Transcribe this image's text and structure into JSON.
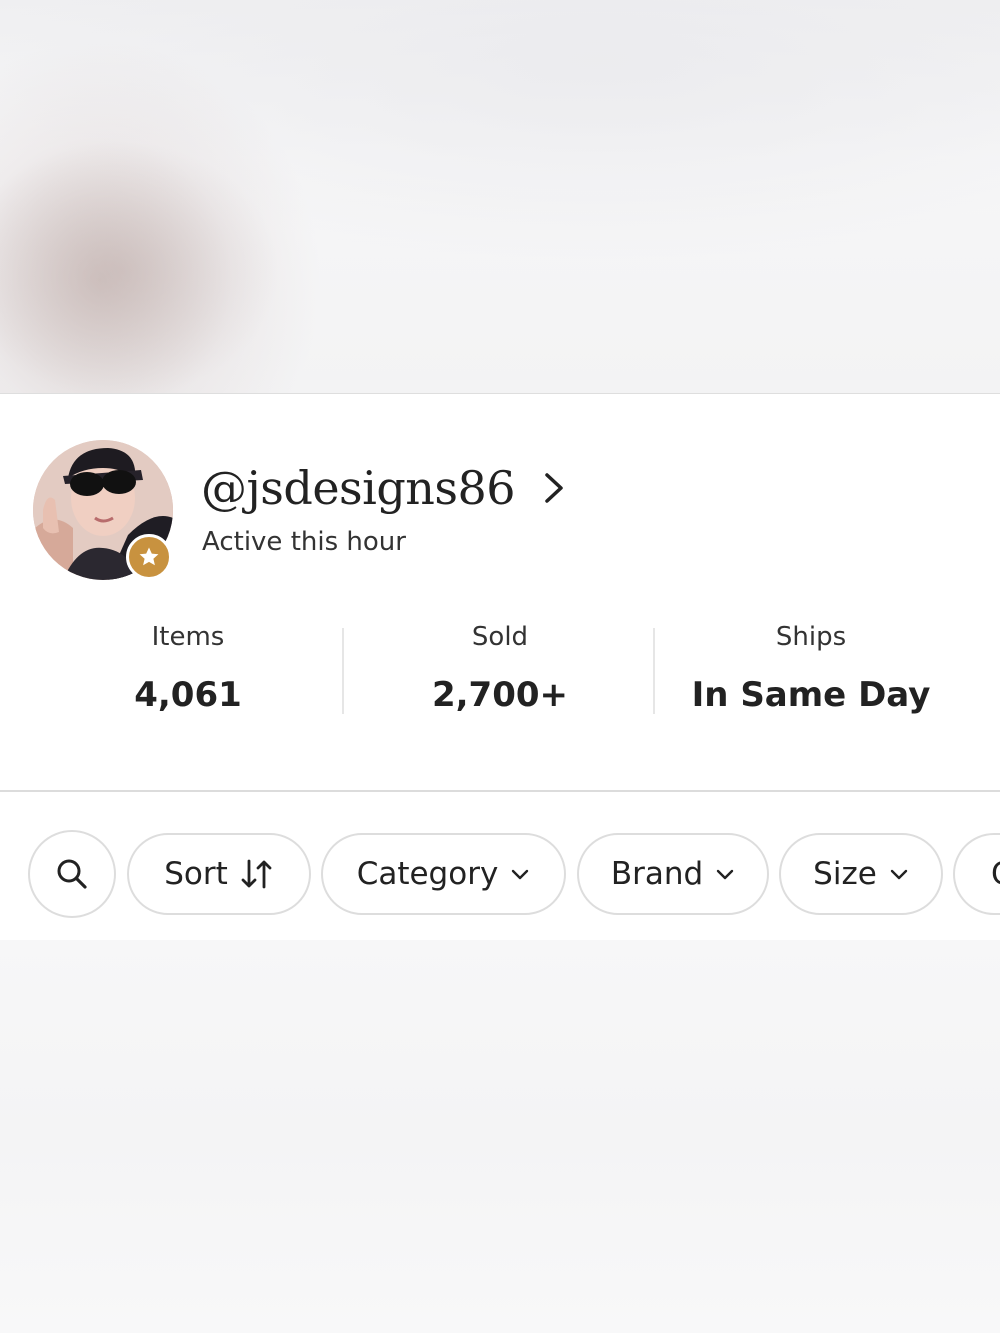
{
  "profile": {
    "username": "@jsdesigns86",
    "status": "Active this hour",
    "badge_icon": "star-icon",
    "badge_color": "#c8923f"
  },
  "stats": [
    {
      "label": "Items",
      "value": "4,061"
    },
    {
      "label": "Sold",
      "value": "2,700+"
    },
    {
      "label": "Ships",
      "value": "In Same Day"
    }
  ],
  "filters": {
    "search_icon": "search-icon",
    "sort": {
      "label": "Sort",
      "icon": "sort-arrows-icon"
    },
    "category": {
      "label": "Category",
      "icon": "chevron-down-icon"
    },
    "brand": {
      "label": "Brand",
      "icon": "chevron-down-icon"
    },
    "size": {
      "label": "Size",
      "icon": "chevron-down-icon"
    },
    "next_partial": {
      "label": "C"
    }
  }
}
